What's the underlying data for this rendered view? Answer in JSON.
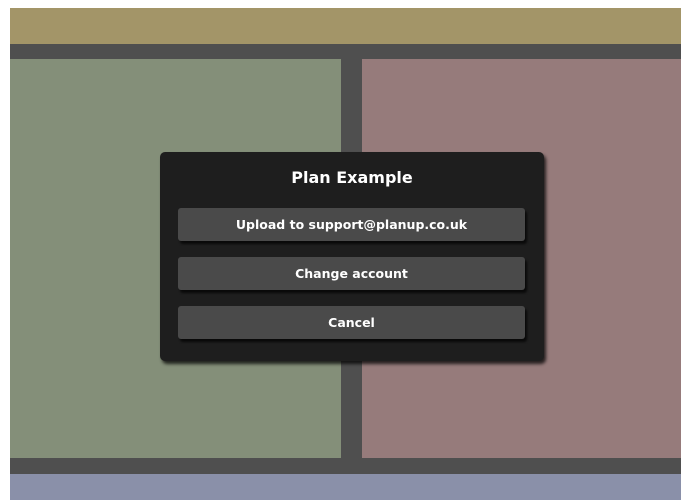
{
  "colors": {
    "top_band": "#a39568",
    "left_panel": "#848f79",
    "right_panel": "#967b7b",
    "bottom_band": "#8a90a9",
    "divider": "#4f4f4f",
    "dialog_bg": "#1e1e1e",
    "button_bg": "#4a4a4a"
  },
  "dialog": {
    "title": "Plan Example",
    "buttons": {
      "upload": "Upload to support@planup.co.uk",
      "change_account": "Change account",
      "cancel": "Cancel"
    }
  }
}
